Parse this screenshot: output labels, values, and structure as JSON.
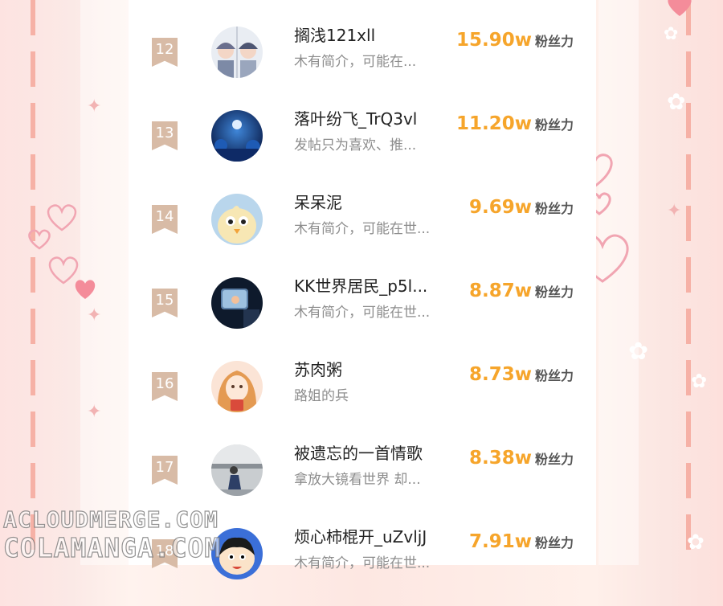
{
  "leaderboard": {
    "fans_label": "粉丝力",
    "rows": [
      {
        "rank": "12",
        "name": "搁浅121xll",
        "bio": "木有简介，可能在...",
        "fans": "15.90w",
        "avatar": "avatar-couple"
      },
      {
        "rank": "13",
        "name": "落叶纷飞_TrQ3vl",
        "bio": "发帖只为喜欢、推...",
        "fans": "11.20w",
        "avatar": "avatar-night-sky"
      },
      {
        "rank": "14",
        "name": "呆呆泥",
        "bio": "木有简介，可能在世...",
        "fans": "9.69w",
        "avatar": "avatar-chick"
      },
      {
        "rank": "15",
        "name": "KK世界居民_p5l...",
        "bio": "木有简介，可能在世...",
        "fans": "8.87w",
        "avatar": "avatar-car-window"
      },
      {
        "rank": "16",
        "name": "苏肉粥",
        "bio": "路姐的兵",
        "fans": "8.73w",
        "avatar": "avatar-anime-girl"
      },
      {
        "rank": "17",
        "name": "被遗忘的一首情歌",
        "bio": "拿放大镜看世界 却...",
        "fans": "8.38w",
        "avatar": "avatar-street-girl"
      },
      {
        "rank": "18",
        "name": "烦心柿棍开_uZvljJ",
        "bio": "木有简介，可能在世...",
        "fans": "7.91w",
        "avatar": "avatar-crayon-boy"
      }
    ]
  },
  "watermark": {
    "line1": "ACLOUDMERGE.COM",
    "line2": "COLAMANGA.COM"
  },
  "colors": {
    "fans_number": "#f6a52b",
    "rank_badge": "#d8bba6",
    "name_text": "#222222",
    "bio_text": "#8d8d8d",
    "frame_stripe": "#f4a497"
  }
}
